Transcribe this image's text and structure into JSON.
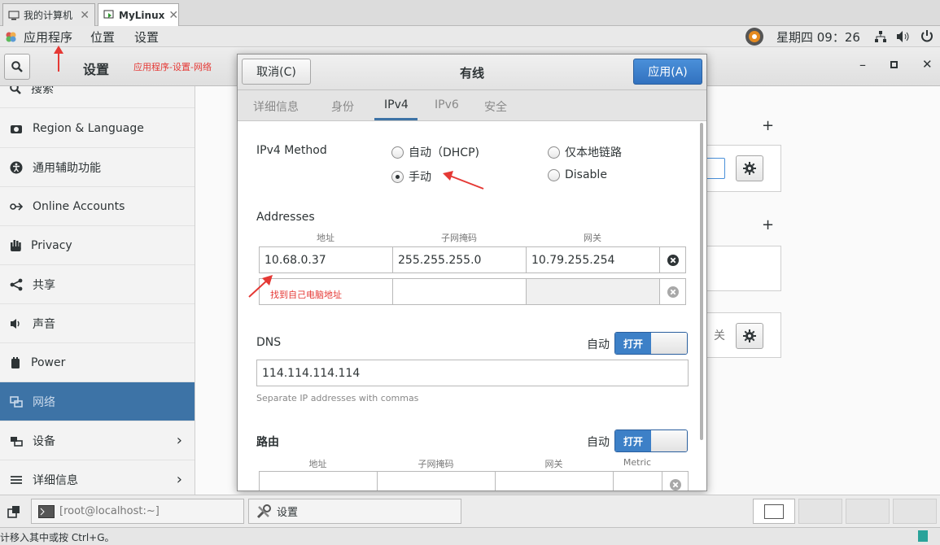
{
  "vm_tabs": [
    {
      "label": "我的计算机",
      "icon": "computer-icon"
    },
    {
      "label": "MyLinux",
      "icon": "vm-icon"
    }
  ],
  "topbar": {
    "menus": [
      "应用程序",
      "位置",
      "设置"
    ],
    "clock": "星期四 09：26"
  },
  "settings": {
    "title": "设置",
    "annotation": "应用程序-设置-网络",
    "sidebar": [
      {
        "label": "搜索",
        "icon": "search-icon"
      },
      {
        "label": "Region & Language",
        "icon": "camera-icon"
      },
      {
        "label": "通用辅助功能",
        "icon": "accessibility-icon"
      },
      {
        "label": "Online Accounts",
        "icon": "online-accounts-icon"
      },
      {
        "label": "Privacy",
        "icon": "hand-icon"
      },
      {
        "label": "共享",
        "icon": "share-icon"
      },
      {
        "label": "声音",
        "icon": "speaker-icon"
      },
      {
        "label": "Power",
        "icon": "power-icon"
      },
      {
        "label": "网络",
        "icon": "network-icon"
      },
      {
        "label": "设备",
        "icon": "devices-icon"
      },
      {
        "label": "详细信息",
        "icon": "info-icon"
      }
    ],
    "content_off_label": "关"
  },
  "dialog": {
    "cancel": "取消(C)",
    "title": "有线",
    "apply": "应用(A)",
    "tabs": [
      "详细信息",
      "身份",
      "IPv4",
      "IPv6",
      "安全"
    ],
    "active_tab": "IPv4",
    "ipv4_method_label": "IPv4 Method",
    "methods": [
      {
        "label": "自动（DHCP)",
        "selected": false
      },
      {
        "label": "仅本地链路",
        "selected": false
      },
      {
        "label": "手动",
        "selected": true
      },
      {
        "label": "Disable",
        "selected": false
      }
    ],
    "addresses_label": "Addresses",
    "address_columns": [
      "地址",
      "子网掩码",
      "网关"
    ],
    "address_rows": [
      [
        "10.68.0.37",
        "255.255.255.0",
        "10.79.255.254"
      ],
      [
        "",
        "",
        ""
      ]
    ],
    "address_note": "找到自己电脑地址",
    "dns_label": "DNS",
    "auto_label": "自动",
    "toggle_on": "打开",
    "dns_value": "114.114.114.114",
    "dns_hint": "Separate IP addresses with commas",
    "routes_label": "路由",
    "route_columns": [
      "地址",
      "子网掩码",
      "网关",
      "Metric"
    ]
  },
  "taskbar": {
    "terminal": "[root@localhost:~]",
    "settings": "设置"
  },
  "statusbar": {
    "hint": "计移入其中或按 Ctrl+G。"
  },
  "colors": {
    "accent": "#3d73a6",
    "annotation": "#e53935"
  }
}
